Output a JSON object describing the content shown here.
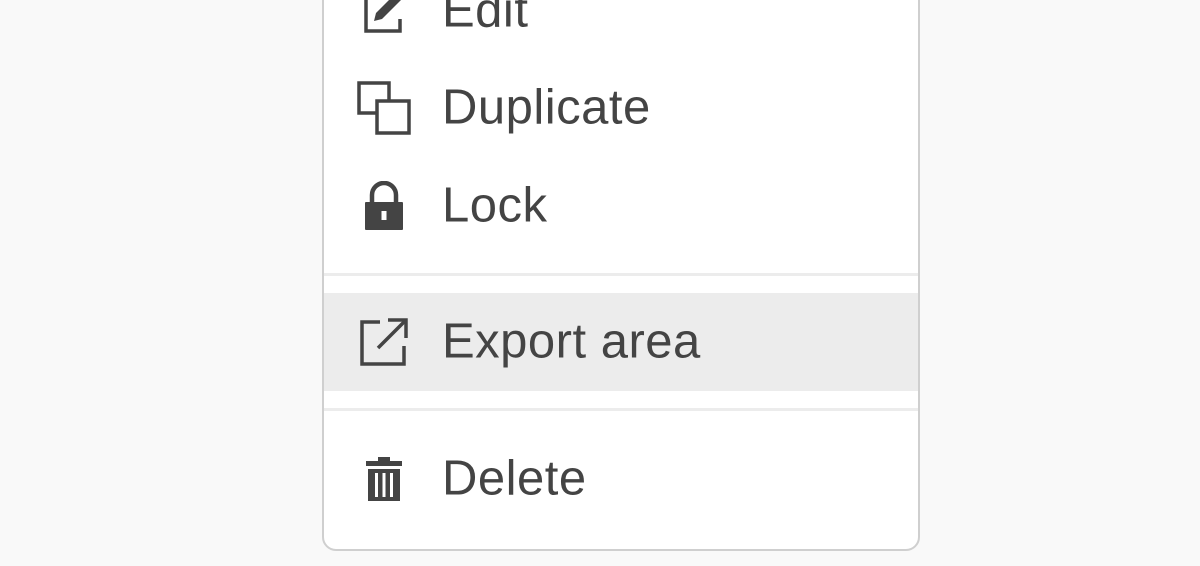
{
  "menu": {
    "items": [
      {
        "label": "Edit",
        "icon": "edit-icon"
      },
      {
        "label": "Duplicate",
        "icon": "duplicate-icon"
      },
      {
        "label": "Lock",
        "icon": "lock-icon"
      },
      {
        "label": "Export area",
        "icon": "export-icon",
        "highlighted": true
      },
      {
        "label": "Delete",
        "icon": "trash-icon"
      }
    ]
  },
  "colors": {
    "background": "#f9f9f9",
    "menu_background": "#ffffff",
    "menu_border": "#cfcfcf",
    "highlight": "#ececec",
    "text": "#444444",
    "icon": "#444444"
  }
}
